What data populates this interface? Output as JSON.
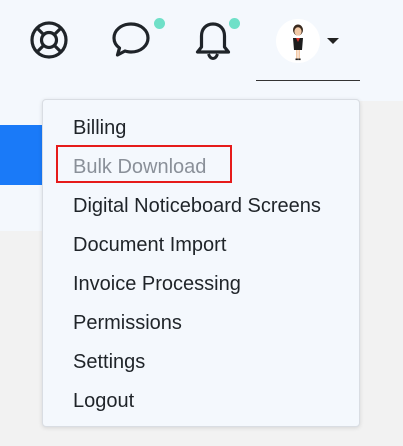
{
  "header": {
    "icons": [
      "lifebuoy-icon",
      "chat-bubble-icon",
      "bell-icon"
    ],
    "notification_dot_color": "#6fe0c8",
    "avatar": "user-avatar"
  },
  "menu": {
    "items": [
      {
        "label": "Billing",
        "state": "normal"
      },
      {
        "label": "Bulk Download",
        "state": "disabled"
      },
      {
        "label": "Digital Noticeboard Screens",
        "state": "normal"
      },
      {
        "label": "Document Import",
        "state": "normal"
      },
      {
        "label": "Invoice Processing",
        "state": "normal"
      },
      {
        "label": "Permissions",
        "state": "normal"
      },
      {
        "label": "Settings",
        "state": "normal"
      },
      {
        "label": "Logout",
        "state": "normal"
      }
    ]
  },
  "colors": {
    "accent_blue": "#1a7af8",
    "highlight_red": "#e61b1b",
    "menu_bg": "#f4f8fd"
  }
}
